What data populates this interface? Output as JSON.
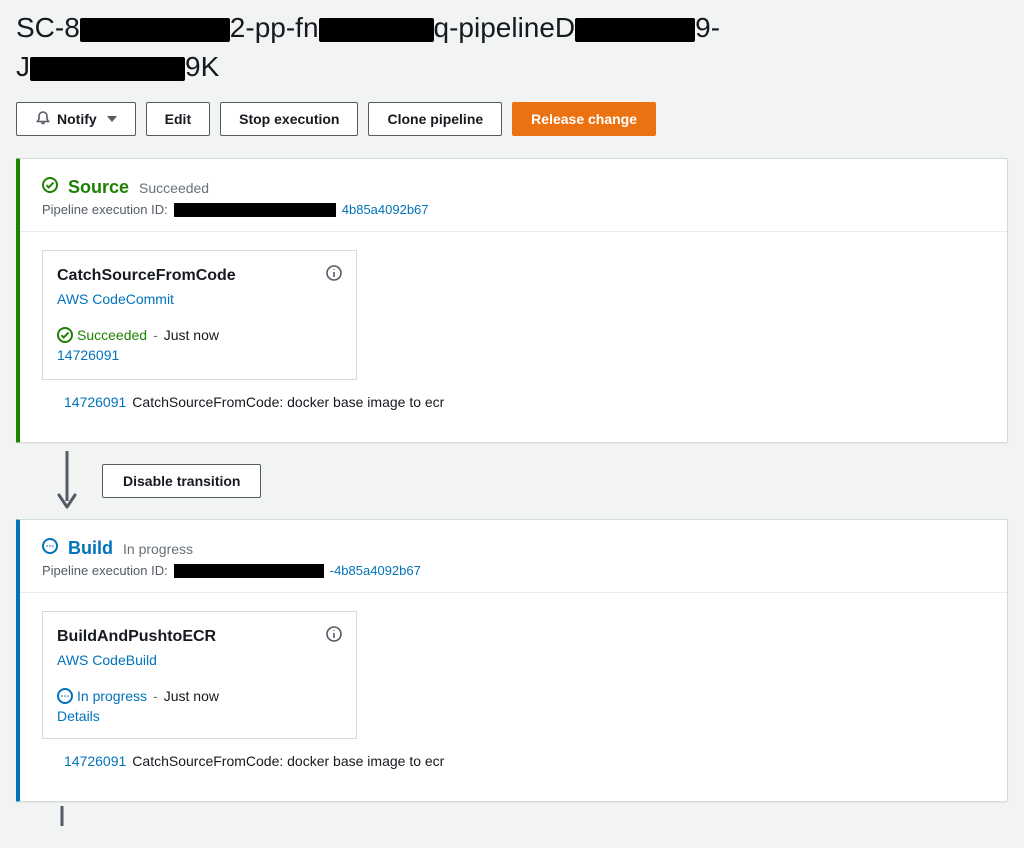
{
  "title": {
    "p0": "SC-8",
    "p1": "2-pp-fn",
    "p2": "q-pipelineD",
    "p3": "9-",
    "p4": "J",
    "p5": "9K"
  },
  "toolbar": {
    "notify_label": "Notify",
    "edit_label": "Edit",
    "stop_label": "Stop execution",
    "clone_label": "Clone pipeline",
    "release_label": "Release change"
  },
  "transition": {
    "disable_label": "Disable transition"
  },
  "stages": {
    "source": {
      "name": "Source",
      "status": "Succeeded",
      "exec_label": "Pipeline execution ID:",
      "exec_suffix": "4b85a4092b67",
      "action": {
        "name": "CatchSourceFromCode",
        "provider": "AWS CodeCommit",
        "status": "Succeeded",
        "time": "Just now",
        "revision": "14726091"
      },
      "footer_rev": "14726091",
      "footer_msg": "CatchSourceFromCode: docker base image to ecr"
    },
    "build": {
      "name": "Build",
      "status": "In progress",
      "exec_label": "Pipeline execution ID:",
      "exec_suffix": "-4b85a4092b67",
      "action": {
        "name": "BuildAndPushtoECR",
        "provider": "AWS CodeBuild",
        "status": "In progress",
        "time": "Just now",
        "details": "Details"
      },
      "footer_rev": "14726091",
      "footer_msg": "CatchSourceFromCode: docker base image to ecr"
    }
  }
}
